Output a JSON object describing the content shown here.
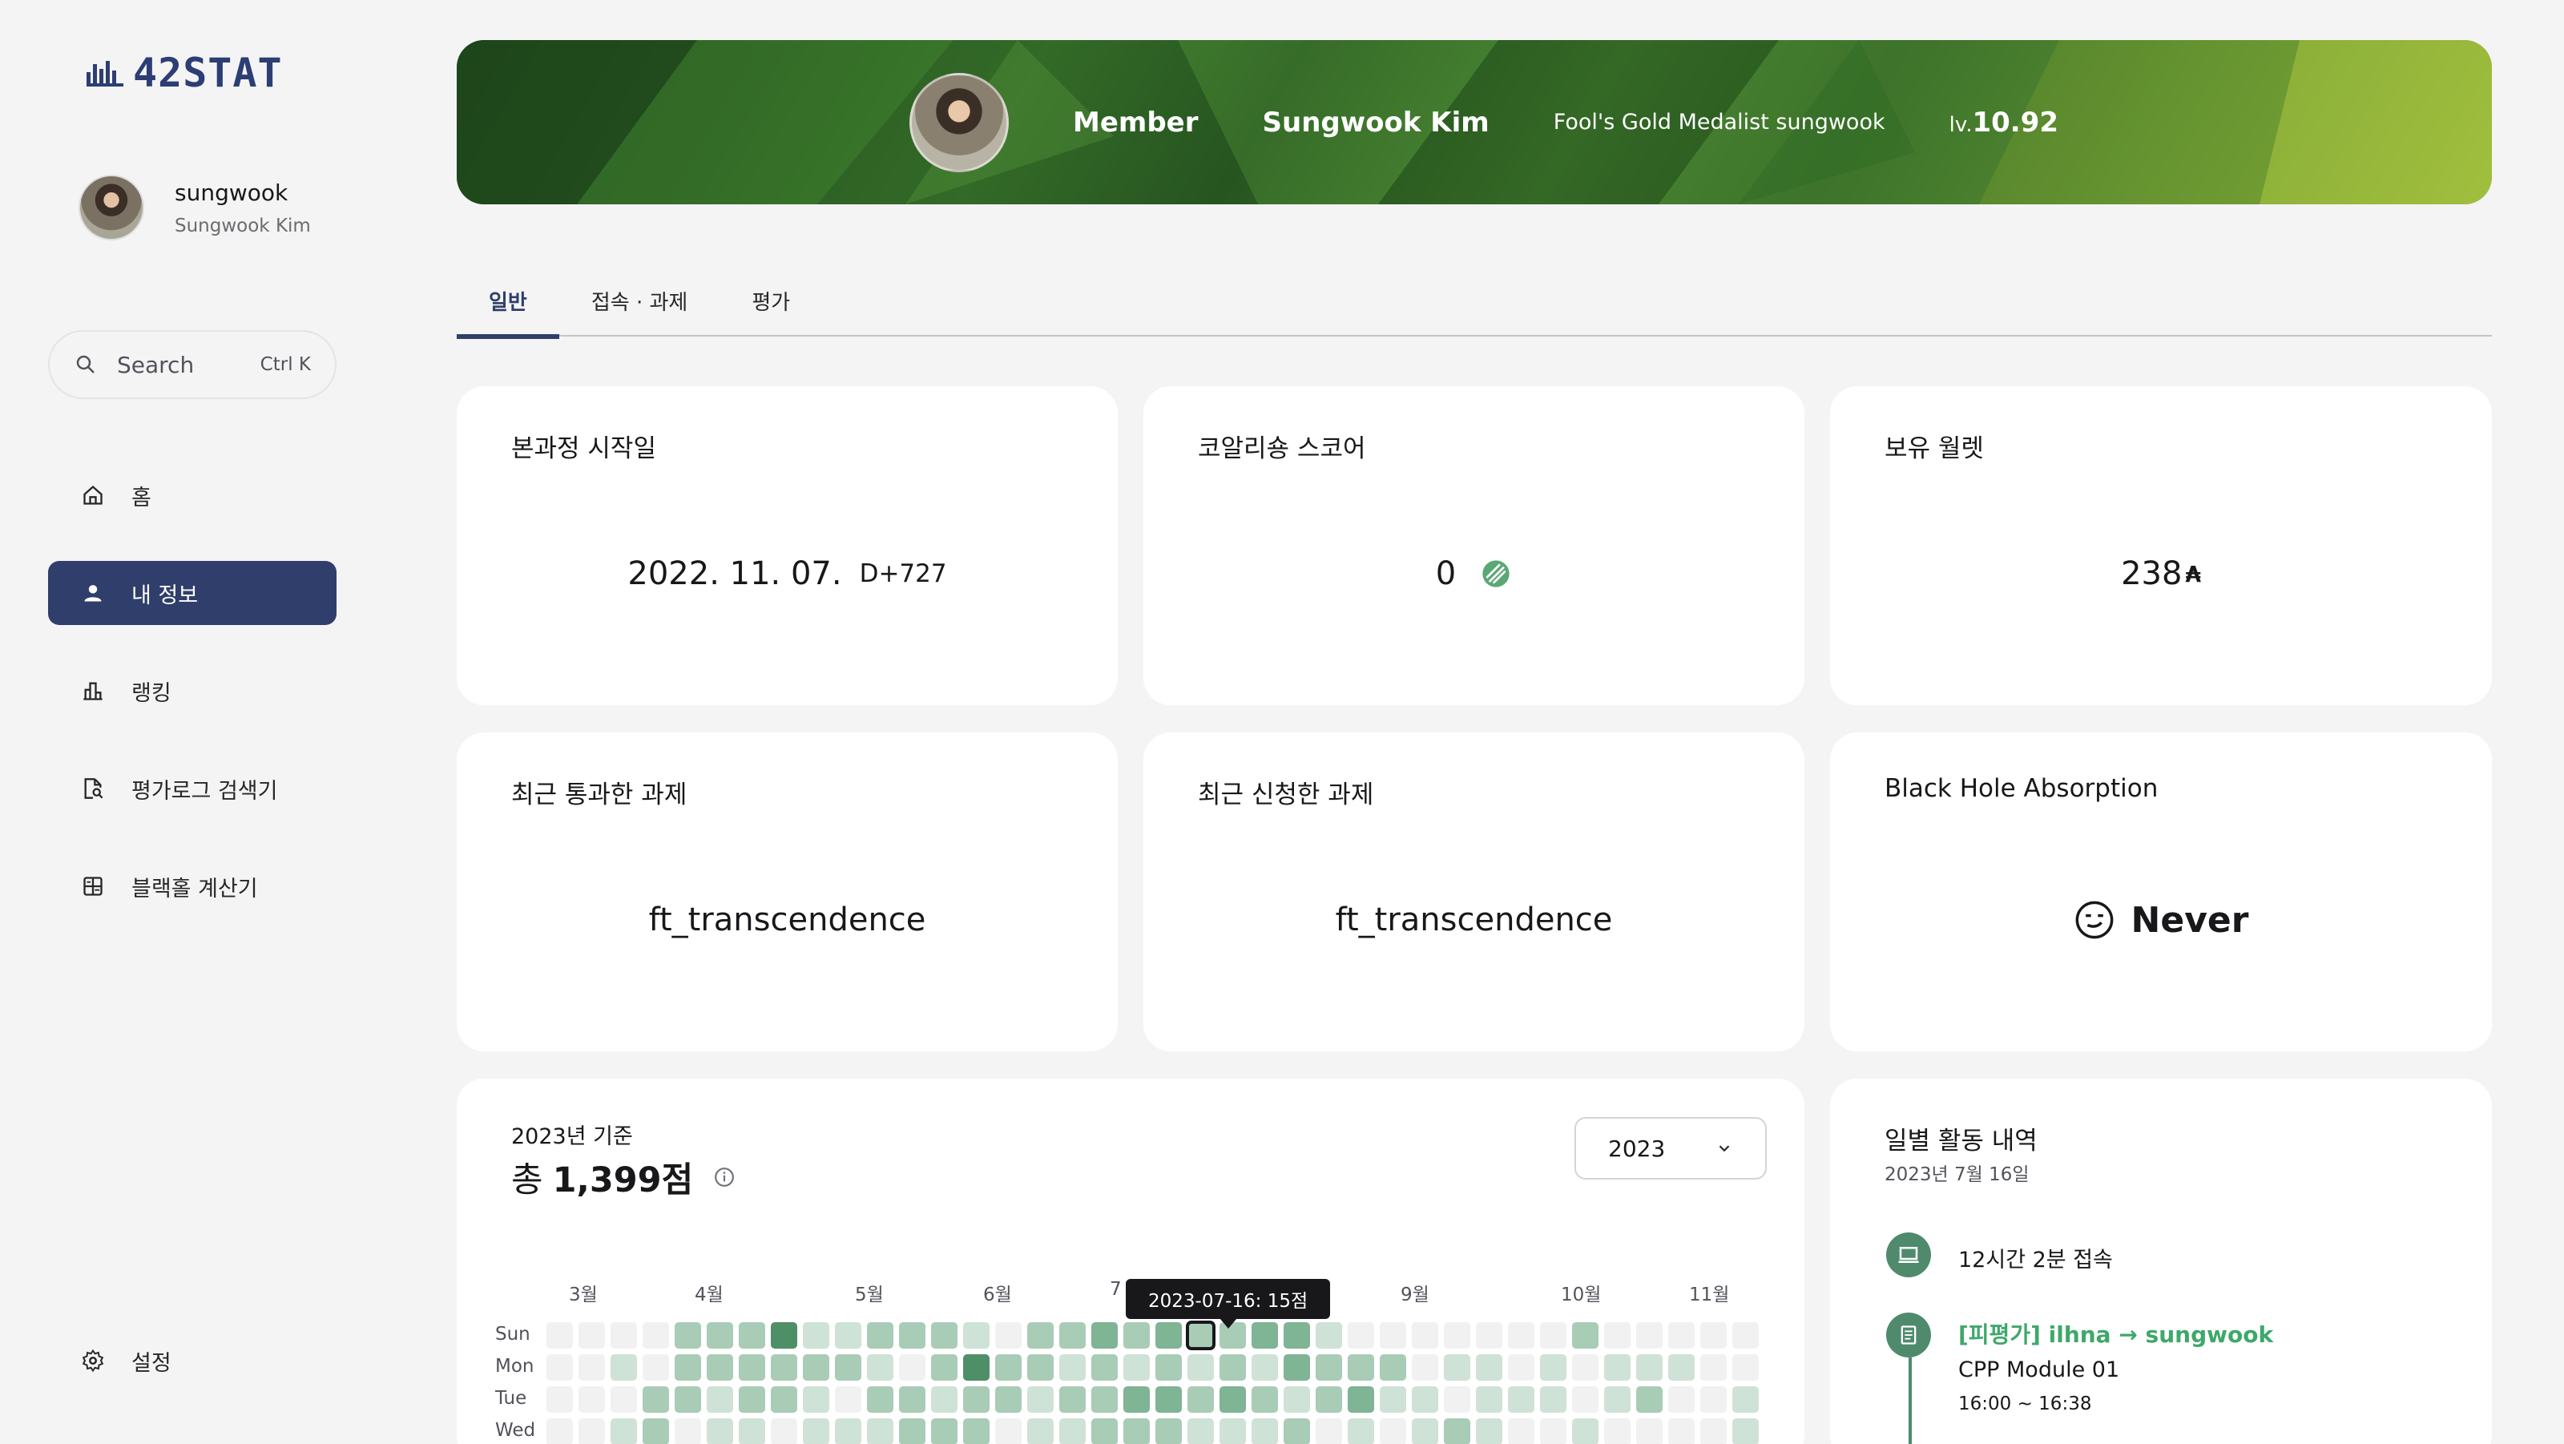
{
  "app": {
    "logo_text": "42STAT"
  },
  "user": {
    "login": "sungwook",
    "full_name": "Sungwook Kim"
  },
  "search": {
    "placeholder": "Search",
    "shortcut": "Ctrl K"
  },
  "nav": [
    {
      "label": "홈",
      "icon": "home-icon",
      "active": false
    },
    {
      "label": "내 정보",
      "icon": "person-icon",
      "active": true
    },
    {
      "label": "랭킹",
      "icon": "bar-chart-icon",
      "active": false
    },
    {
      "label": "평가로그 검색기",
      "icon": "doc-search-icon",
      "active": false
    },
    {
      "label": "블랙홀 계산기",
      "icon": "calculator-icon",
      "active": false
    }
  ],
  "settings_label": "설정",
  "banner": {
    "role": "Member",
    "name": "Sungwook Kim",
    "title": "Fool's Gold Medalist sungwook",
    "level_prefix": "lv.",
    "level": "10.92"
  },
  "tabs": [
    "일반",
    "접속 · 과제",
    "평가"
  ],
  "cards": {
    "start_date": {
      "title": "본과정 시작일",
      "date": "2022. 11. 07.",
      "dday": "D+727"
    },
    "coalition": {
      "title": "코알리숑 스코어",
      "score": "0"
    },
    "wallet": {
      "title": "보유 월렛",
      "amount": "238",
      "unit": "₳"
    },
    "last_passed": {
      "title": "최근 통과한 과제",
      "project": "ft_transcendence"
    },
    "last_registered": {
      "title": "최근 신청한 과제",
      "project": "ft_transcendence"
    },
    "blackhole": {
      "title": "Black Hole Absorption",
      "value": "Never"
    }
  },
  "heatmap": {
    "subtitle": "2023년 기준",
    "total_prefix": "총",
    "total_value": "1,399점",
    "year_selected": "2023",
    "months": [
      "3월",
      "4월",
      "5월",
      "6월",
      "7",
      "9월",
      "10월",
      "11월"
    ],
    "days": [
      "Sun",
      "Mon",
      "Tue",
      "Wed"
    ],
    "tooltip": "2023-07-16: 15점",
    "levels": [
      [
        0,
        0,
        0,
        0,
        2,
        2,
        2,
        4,
        1,
        1,
        2,
        2,
        2,
        1,
        0,
        2,
        2,
        3,
        2,
        3,
        2,
        2,
        3,
        3,
        1,
        0,
        0,
        0,
        0,
        0,
        0,
        0,
        2,
        0,
        0,
        0,
        0,
        0
      ],
      [
        0,
        0,
        1,
        0,
        2,
        2,
        2,
        2,
        2,
        2,
        1,
        0,
        2,
        4,
        2,
        2,
        1,
        2,
        1,
        2,
        1,
        2,
        1,
        3,
        2,
        2,
        2,
        0,
        1,
        1,
        0,
        1,
        0,
        1,
        1,
        1,
        0,
        0
      ],
      [
        0,
        0,
        0,
        2,
        2,
        1,
        2,
        2,
        1,
        0,
        2,
        2,
        1,
        2,
        2,
        1,
        2,
        2,
        3,
        3,
        2,
        3,
        2,
        1,
        2,
        3,
        1,
        1,
        0,
        1,
        1,
        1,
        0,
        1,
        2,
        0,
        0,
        1
      ],
      [
        0,
        0,
        1,
        2,
        0,
        1,
        1,
        0,
        1,
        1,
        1,
        2,
        2,
        2,
        0,
        1,
        1,
        2,
        2,
        2,
        1,
        1,
        1,
        2,
        0,
        1,
        0,
        1,
        2,
        1,
        0,
        0,
        1,
        0,
        0,
        0,
        0,
        1
      ]
    ],
    "palette": [
      "#f1f1f2",
      "#cfe2d7",
      "#a9ccb6",
      "#7fb494",
      "#4f8f67"
    ]
  },
  "activity": {
    "title": "일별 활동 내역",
    "date": "2023년 7월 16일",
    "items": [
      {
        "icon": "laptop-icon",
        "text": "12시간 2분 접속"
      },
      {
        "icon": "document-icon",
        "link": "[피평가] ilhna → sungwook",
        "project": "CPP Module 01",
        "time": "16:00 ~ 16:38"
      }
    ]
  }
}
